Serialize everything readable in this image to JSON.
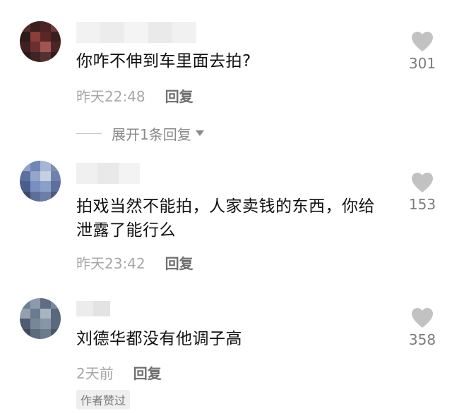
{
  "colors": {
    "heart": "#c2c2c2",
    "text": "#111111",
    "meta": "#a7a7a7",
    "reply": "#6f6f6f"
  },
  "comments": [
    {
      "text": "你咋不伸到车里面去拍?",
      "time": "昨天22:48",
      "reply_label": "回复",
      "like_count": "301",
      "expand_label": "展开1条回复"
    },
    {
      "text": "拍戏当然不能拍，人家卖钱的东西，你给泄露了能行么",
      "time": "昨天23:42",
      "reply_label": "回复",
      "like_count": "153"
    },
    {
      "text": "刘德华都没有他调子高",
      "time": "2天前",
      "reply_label": "回复",
      "like_count": "358",
      "badge": "作者赞过"
    }
  ],
  "icons": {
    "like": "heart-icon",
    "expand": "triangle-down-icon"
  }
}
